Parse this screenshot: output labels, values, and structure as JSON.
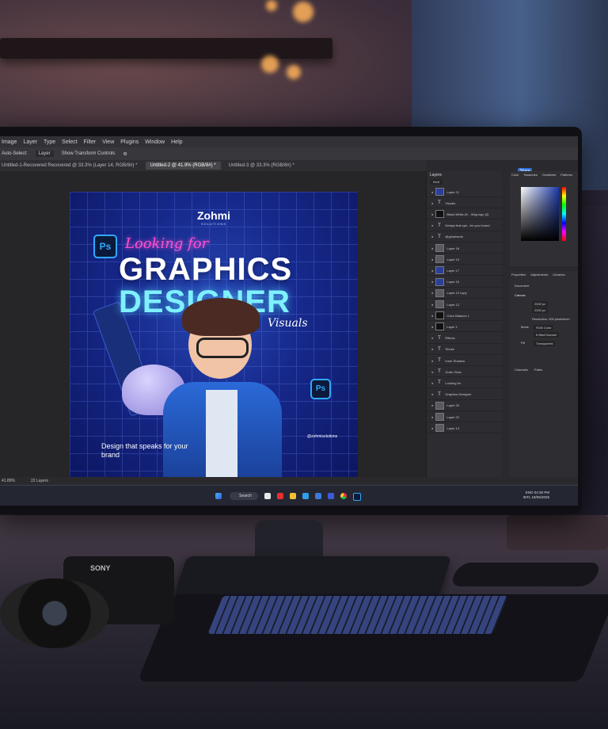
{
  "menu": {
    "items": [
      "Image",
      "Layer",
      "Type",
      "Select",
      "Filter",
      "View",
      "Plugins",
      "Window",
      "Help"
    ]
  },
  "options": {
    "auto_select": "Auto-Select:",
    "auto_select_value": "Layer",
    "show_transform": "Show Transform Controls"
  },
  "tabs": [
    "Untitled-1-Recovered Recovered @ 33.3% (Layer 14, RGB/8#) *",
    "Untitled-2 @ 41.9% (RGB/8#) *",
    "Untitled-3 @ 33.3% (RGB/8#) *"
  ],
  "share_label": "Share",
  "artwork": {
    "brand": "Zohmi",
    "brand_sub": "SOLUTIONS",
    "looking": "Looking for",
    "title_line1": "GRAPHICS",
    "title_line2": "DESIGNER",
    "visuals": "Visuals",
    "ps_badge": "Ps",
    "tagline": "Design that speaks for your brand",
    "handle": "@zohmisolutions"
  },
  "layers_panel": {
    "title": "Layers",
    "filter": "Kind",
    "rows": [
      {
        "name": "Layer 21",
        "thumb": "blue"
      },
      {
        "name": "Visuals",
        "thumb": "txt"
      },
      {
        "name": "Black-White-M... Wag logo [2]",
        "thumb": "dark"
      },
      {
        "name": "Design that spe...for your brand",
        "thumb": "txt"
      },
      {
        "name": "@gfxartwork",
        "thumb": "txt"
      },
      {
        "name": "Layer 18",
        "thumb": "gray"
      },
      {
        "name": "Layer 19",
        "thumb": "gray"
      },
      {
        "name": "Layer 17",
        "thumb": "blue"
      },
      {
        "name": "Layer 16",
        "thumb": "blue"
      },
      {
        "name": "Layer 12 copy",
        "thumb": "gray"
      },
      {
        "name": "Layer 12",
        "thumb": "gray"
      },
      {
        "name": "Color Balance 1",
        "thumb": "dark"
      },
      {
        "name": "Layer 1",
        "thumb": "dark"
      },
      {
        "name": "Effects",
        "thumb": "txt"
      },
      {
        "name": "Stroke",
        "thumb": "txt"
      },
      {
        "name": "Inner Shadow",
        "thumb": "txt"
      },
      {
        "name": "Outer Glow",
        "thumb": "txt"
      },
      {
        "name": "Looking for",
        "thumb": "txt"
      },
      {
        "name": "Graphics Designer",
        "thumb": "txt"
      },
      {
        "name": "Layer 20",
        "thumb": "gray"
      },
      {
        "name": "Layer 22",
        "thumb": "gray"
      },
      {
        "name": "Layer 13",
        "thumb": "gray"
      }
    ]
  },
  "color_panel": {
    "tabs": [
      "Color",
      "Swatches",
      "Gradients",
      "Patterns"
    ]
  },
  "properties": {
    "tabs": [
      "Properties",
      "Adjustments",
      "Libraries"
    ],
    "document": "Document",
    "canvas": "Canvas",
    "w": "2000 px",
    "h": "2000 px",
    "resolution": "Resolution: 300 pixels/inch",
    "mode_label": "Mode",
    "mode": "RGB Color",
    "bit_depth": "8 Bits/Channel",
    "fill_label": "Fill",
    "fill": "Transparent",
    "bottom_tabs": [
      "Channels",
      "Paths"
    ]
  },
  "status": {
    "zoom": "41.89%",
    "layers_count": "22 Layers"
  },
  "taskbar": {
    "search": "Search",
    "lang": "ENG",
    "region": "INTL",
    "time": "04:30 PM",
    "date": "18/05/2025"
  },
  "camera": {
    "brand": "SONY"
  },
  "colors": {
    "ps_blue": "#31a8ff",
    "title_white": "#ffffff",
    "designer_cyan": "#7ff0ff",
    "looking_pink": "#ff4fd0",
    "art_blue": "#16288a"
  }
}
